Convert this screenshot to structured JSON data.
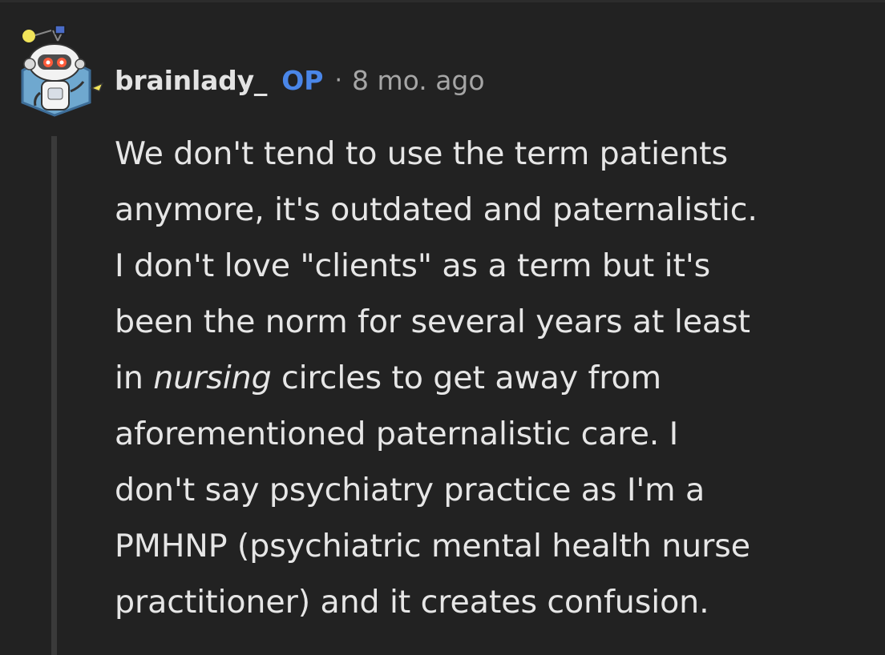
{
  "comment": {
    "author": "brainlady_",
    "op_badge": "OP",
    "separator": "·",
    "timestamp": "8 mo. ago",
    "avatar": "snoo-robot-avatar",
    "body_lines": [
      {
        "text": "We don't tend to use the term patients"
      },
      {
        "text": "anymore, it's outdated and paternalistic."
      },
      {
        "text": "I don't love \"clients\" as a term but it's"
      },
      {
        "text": "been the norm for several years at least"
      },
      {
        "pre": "in ",
        "em": "nursing",
        "post": " circles to get away from"
      },
      {
        "text": "aforementioned paternalistic care. I"
      },
      {
        "text": "don't say psychiatry practice as I'm a"
      },
      {
        "text": "PMHNP (psychiatric mental health nurse"
      },
      {
        "text": "practitioner) and it creates confusion."
      }
    ]
  },
  "colors": {
    "background": "#222222",
    "op_badge": "#4a86e8",
    "meta_text": "#a6a6a6",
    "thread_line": "#3a3a3a"
  }
}
